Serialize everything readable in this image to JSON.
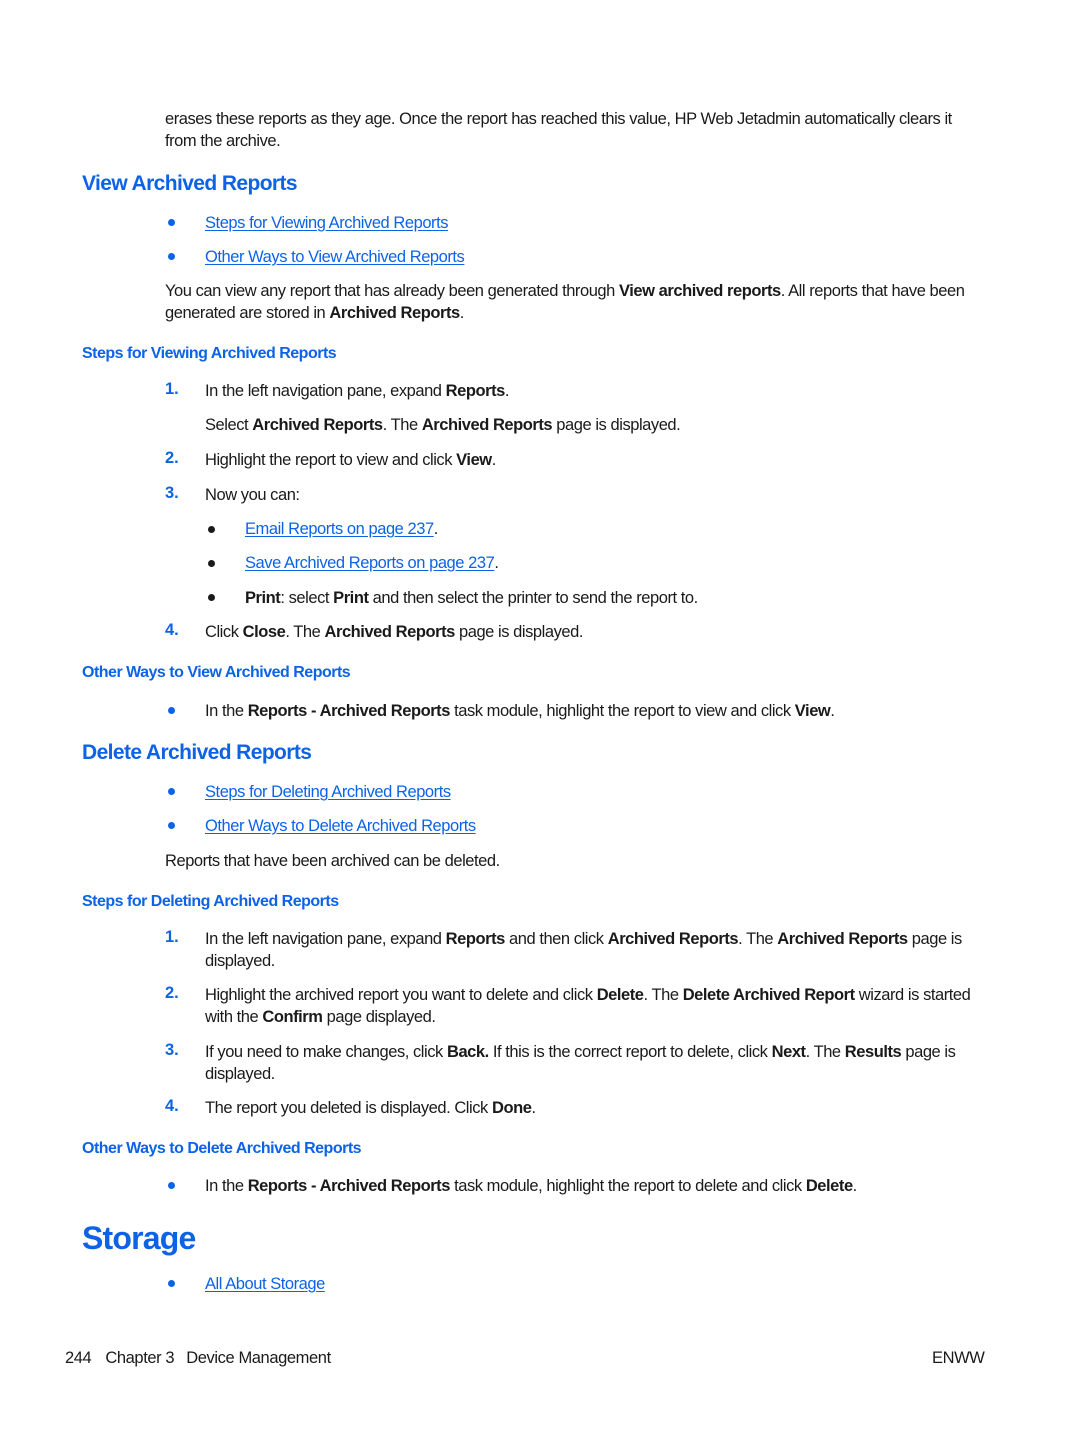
{
  "colors": {
    "accent": "#0d63e6",
    "text": "#1a1a1a"
  },
  "intro": [
    {
      "t": "erases these reports as they age. Once the report has reached this value, HP Web Jetadmin automatically clears it from the archive.",
      "b": false
    }
  ],
  "view_section": {
    "title": "View Archived Reports",
    "links": [
      "Steps for Viewing Archived Reports",
      "Other Ways to View Archived Reports"
    ],
    "paragraph": [
      {
        "t": "You can view any report that has already been generated through ",
        "b": false
      },
      {
        "t": "View archived reports",
        "b": true
      },
      {
        "t": ". All reports that have been generated are stored in ",
        "b": false
      },
      {
        "t": "Archived Reports",
        "b": true
      },
      {
        "t": ".",
        "b": false
      }
    ],
    "steps_title": "Steps for Viewing Archived Reports",
    "steps": [
      {
        "n": "1.",
        "text": [
          {
            "t": "In the left navigation pane, expand ",
            "b": false
          },
          {
            "t": "Reports",
            "b": true
          },
          {
            "t": ".",
            "b": false
          }
        ]
      },
      {
        "n": "",
        "text": [
          {
            "t": "Select ",
            "b": false
          },
          {
            "t": "Archived Reports",
            "b": true
          },
          {
            "t": ". The ",
            "b": false
          },
          {
            "t": "Archived Reports",
            "b": true
          },
          {
            "t": " page is displayed.",
            "b": false
          }
        ]
      },
      {
        "n": "2.",
        "text": [
          {
            "t": "Highlight the report to view and click ",
            "b": false
          },
          {
            "t": "View",
            "b": true
          },
          {
            "t": ".",
            "b": false
          }
        ]
      },
      {
        "n": "3.",
        "text": [
          {
            "t": "Now you can:",
            "b": false
          }
        ]
      }
    ],
    "sub_items": [
      {
        "link": "Email Reports on page 237",
        "after": "."
      },
      {
        "link": "Save Archived Reports on page 237",
        "after": "."
      }
    ],
    "print_item": [
      {
        "t": "Print",
        "b": true
      },
      {
        "t": ": select ",
        "b": false
      },
      {
        "t": "Print",
        "b": true
      },
      {
        "t": " and then select the printer to send the report to.",
        "b": false
      }
    ],
    "step4": {
      "n": "4.",
      "text": [
        {
          "t": "Click ",
          "b": false
        },
        {
          "t": "Close",
          "b": true
        },
        {
          "t": ". The ",
          "b": false
        },
        {
          "t": "Archived Reports",
          "b": true
        },
        {
          "t": " page is displayed.",
          "b": false
        }
      ]
    },
    "other_title": "Other Ways to View Archived Reports",
    "other_item": [
      {
        "t": "In the ",
        "b": false
      },
      {
        "t": "Reports - Archived Reports",
        "b": true
      },
      {
        "t": " task module, highlight the report to view and click ",
        "b": false
      },
      {
        "t": "View",
        "b": true
      },
      {
        "t": ".",
        "b": false
      }
    ]
  },
  "delete_section": {
    "title": "Delete Archived Reports",
    "links": [
      "Steps for Deleting Archived Reports",
      "Other Ways to Delete Archived Reports"
    ],
    "paragraph": [
      {
        "t": "Reports that have been archived can be deleted.",
        "b": false
      }
    ],
    "steps_title": "Steps for Deleting Archived Reports",
    "steps": [
      {
        "n": "1.",
        "text": [
          {
            "t": "In the left navigation pane, expand ",
            "b": false
          },
          {
            "t": "Reports",
            "b": true
          },
          {
            "t": " and then click ",
            "b": false
          },
          {
            "t": "Archived Reports",
            "b": true
          },
          {
            "t": ". The ",
            "b": false
          },
          {
            "t": "Archived Reports",
            "b": true
          },
          {
            "t": " page is displayed.",
            "b": false
          }
        ]
      },
      {
        "n": "2.",
        "text": [
          {
            "t": "Highlight the archived report you want to delete and click ",
            "b": false
          },
          {
            "t": "Delete",
            "b": true
          },
          {
            "t": ". The ",
            "b": false
          },
          {
            "t": "Delete Archived Report",
            "b": true
          },
          {
            "t": " wizard is started with the ",
            "b": false
          },
          {
            "t": "Confirm",
            "b": true
          },
          {
            "t": " page displayed.",
            "b": false
          }
        ]
      },
      {
        "n": "3.",
        "text": [
          {
            "t": "If you need to make changes, click ",
            "b": false
          },
          {
            "t": "Back.",
            "b": true
          },
          {
            "t": " If this is the correct report to delete, click ",
            "b": false
          },
          {
            "t": "Next",
            "b": true
          },
          {
            "t": ". The ",
            "b": false
          },
          {
            "t": "Results",
            "b": true
          },
          {
            "t": " page is displayed.",
            "b": false
          }
        ]
      },
      {
        "n": "4.",
        "text": [
          {
            "t": "The report you deleted is displayed. Click ",
            "b": false
          },
          {
            "t": "Done",
            "b": true
          },
          {
            "t": ".",
            "b": false
          }
        ]
      }
    ],
    "other_title": "Other Ways to Delete Archived Reports",
    "other_item": [
      {
        "t": "In the ",
        "b": false
      },
      {
        "t": "Reports - Archived Reports",
        "b": true
      },
      {
        "t": " task module, highlight the report to delete and click ",
        "b": false
      },
      {
        "t": "Delete",
        "b": true
      },
      {
        "t": ".",
        "b": false
      }
    ]
  },
  "storage_section": {
    "title": "Storage",
    "links": [
      "All About Storage"
    ]
  },
  "footer": {
    "page_number": "244",
    "chapter": "Chapter 3",
    "chapter_title": "Device Management",
    "locale": "ENWW"
  }
}
